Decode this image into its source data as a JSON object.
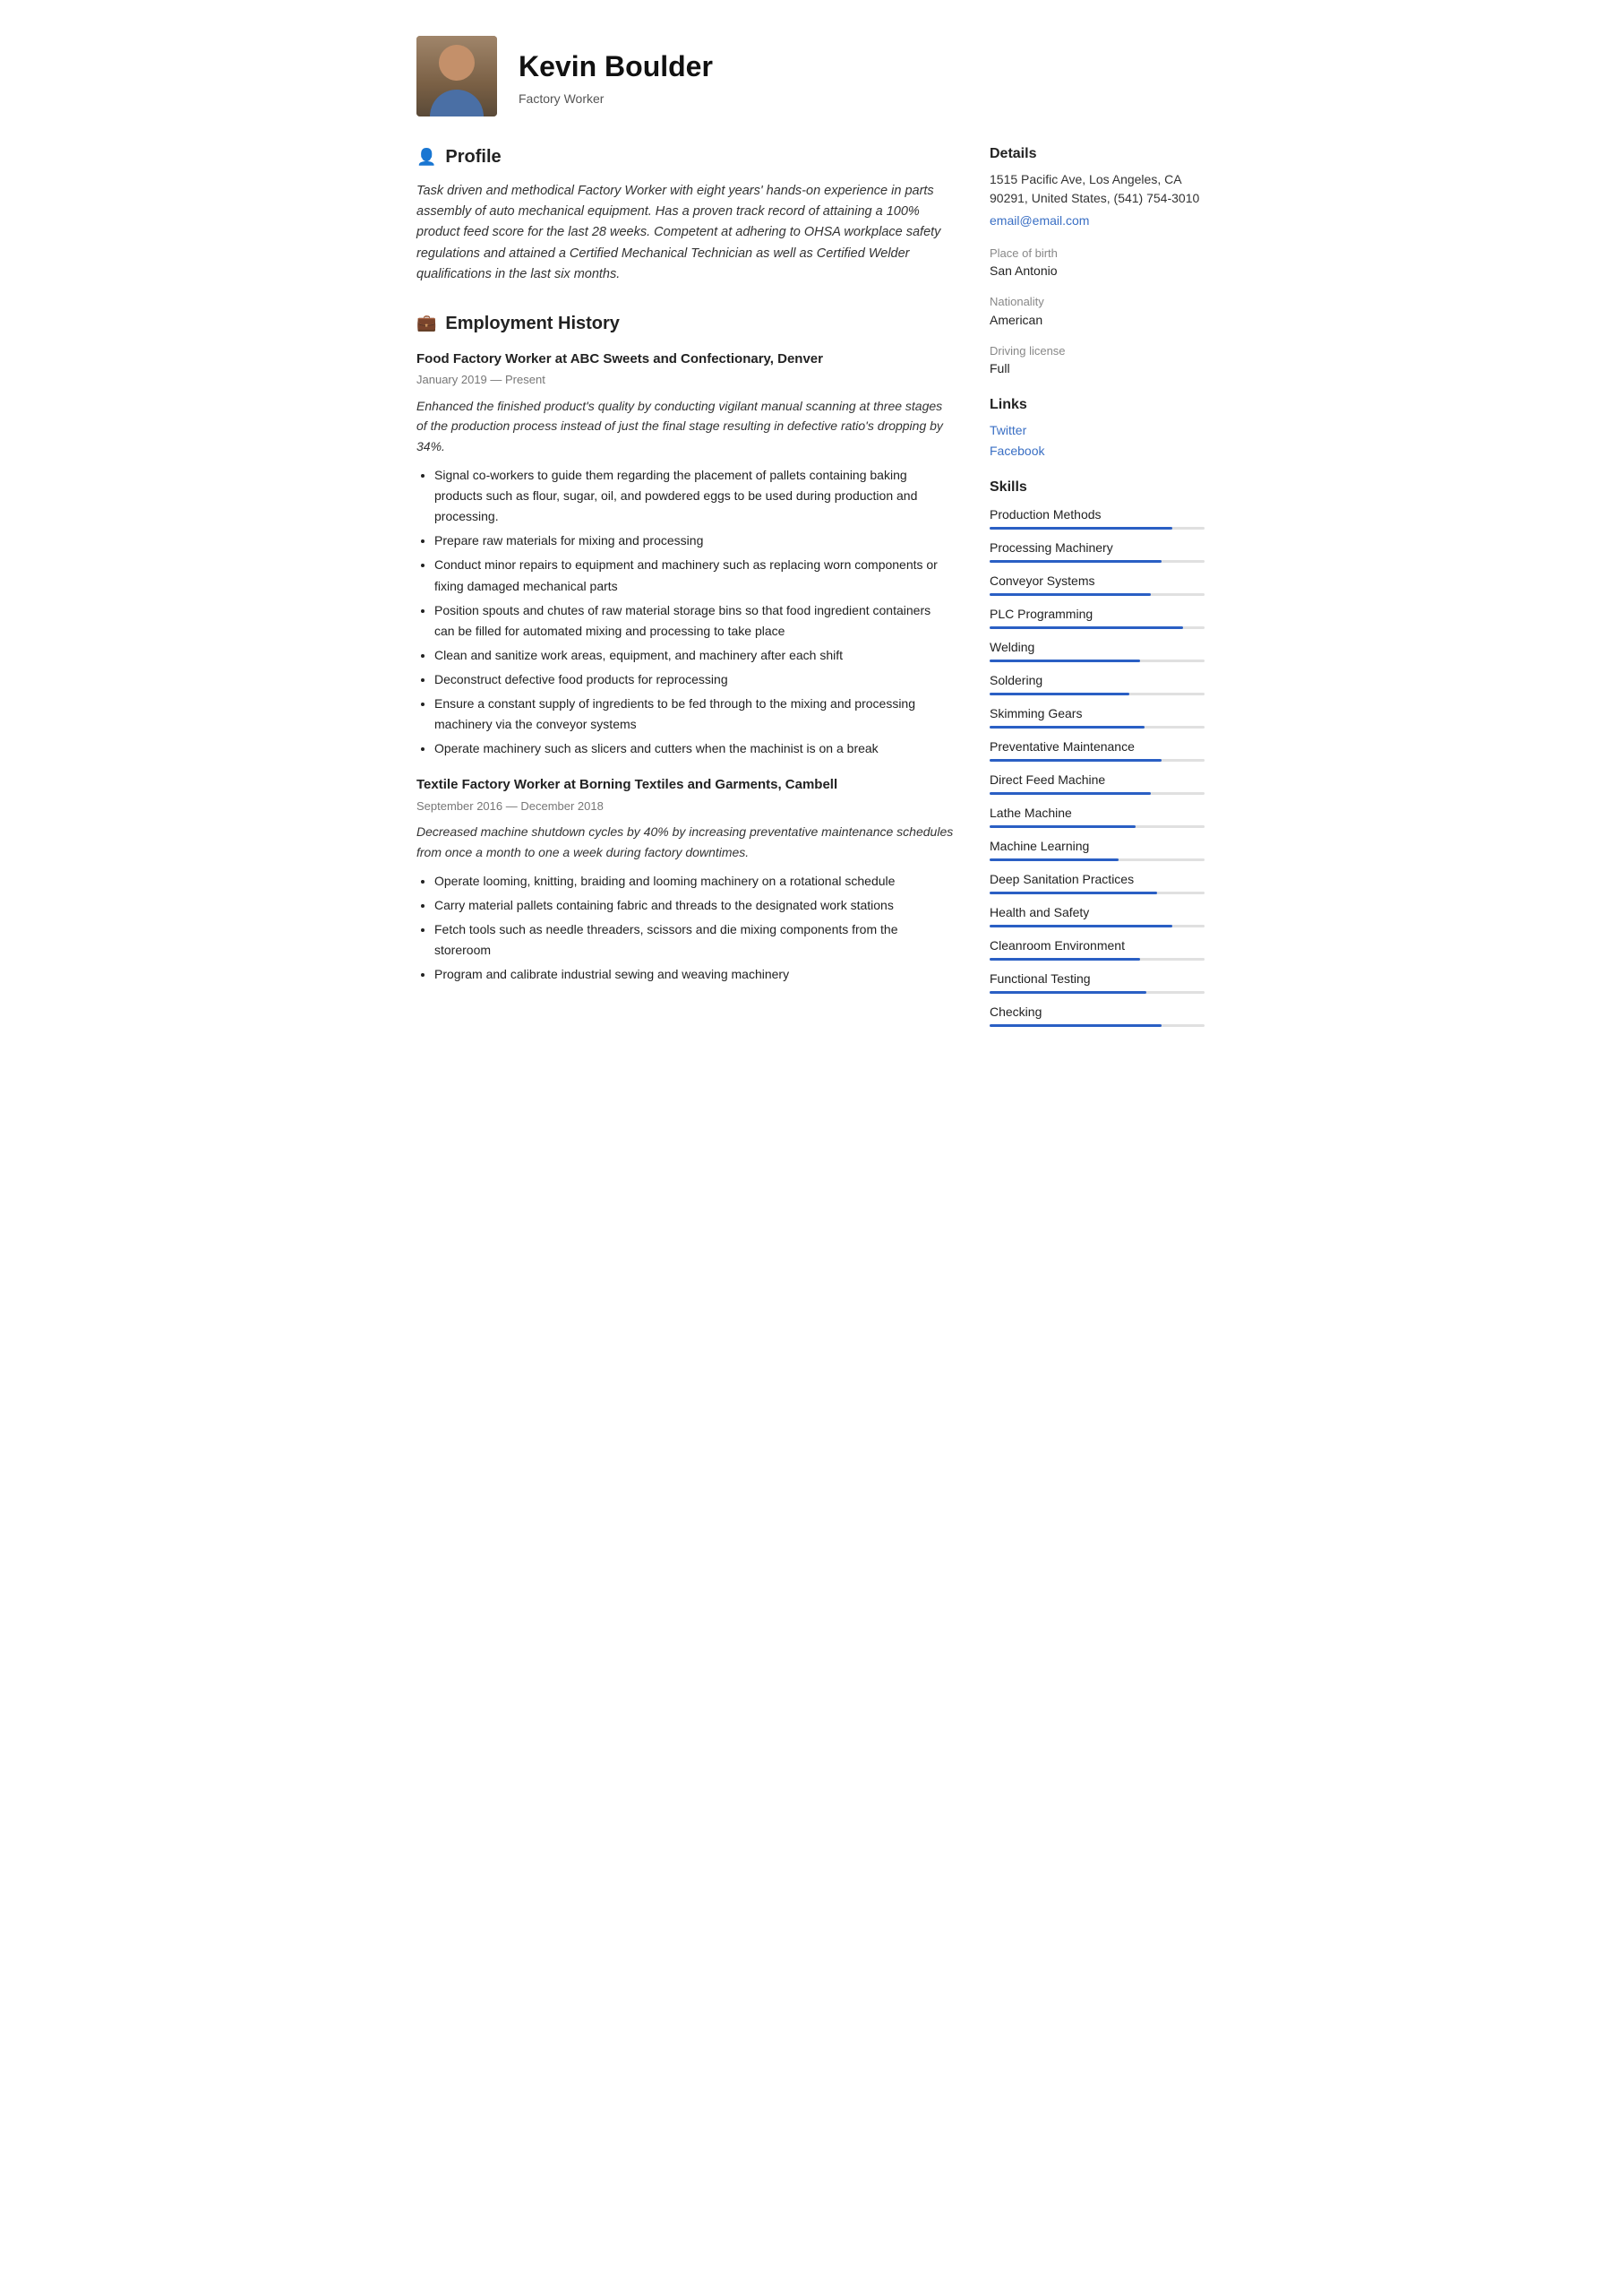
{
  "header": {
    "name": "Kevin Boulder",
    "subtitle": "Factory Worker"
  },
  "profile": {
    "section_title": "Profile",
    "text": "Task driven and methodical Factory Worker with eight years' hands-on experience in parts assembly of auto mechanical equipment. Has a proven track record of attaining a 100% product feed score for the last 28 weeks. Competent at adhering to OHSA workplace safety regulations and attained a Certified Mechanical Technician as well as Certified Welder qualifications in the last six months."
  },
  "employment": {
    "section_title": "Employment History",
    "jobs": [
      {
        "title": "Food Factory Worker at  ABC Sweets and Confectionary, Denver",
        "date": "January 2019 — Present",
        "desc": "Enhanced the finished product's quality by conducting vigilant manual scanning at three stages of the production process instead of just the final stage resulting in defective ratio's dropping by 34%.",
        "bullets": [
          "Signal co-workers to guide them regarding the placement of pallets containing baking products such as flour, sugar, oil, and powdered eggs to be used during production and processing.",
          "Prepare raw materials for mixing and processing",
          "Conduct minor repairs to equipment and machinery such as replacing worn components or fixing damaged mechanical parts",
          "Position spouts and chutes of raw material storage bins so that food ingredient containers can be filled for automated mixing and processing to take place",
          "Clean and sanitize work areas, equipment, and machinery after each shift",
          "Deconstruct defective food products for reprocessing",
          "Ensure a constant supply of ingredients to be fed through to the mixing and processing machinery via the conveyor systems",
          "Operate machinery such as slicers and cutters when the machinist is on a break"
        ]
      },
      {
        "title": "Textile Factory Worker at  Borning Textiles and Garments, Cambell",
        "date": "September 2016 — December 2018",
        "desc": "Decreased machine shutdown cycles by 40% by increasing preventative maintenance schedules from once a month to one a week during factory downtimes.",
        "bullets": [
          "Operate looming, knitting, braiding and looming machinery on a rotational schedule",
          "Carry material pallets containing fabric and threads to the designated work stations",
          "Fetch tools such as needle threaders, scissors and die mixing components from the storeroom",
          "Program and calibrate industrial sewing and weaving machinery"
        ]
      }
    ]
  },
  "details": {
    "title": "Details",
    "address": "1515 Pacific Ave, Los Angeles, CA 90291, United States, (541) 754-3010",
    "email": "email@email.com",
    "place_of_birth_label": "Place of birth",
    "place_of_birth": "San Antonio",
    "nationality_label": "Nationality",
    "nationality": "American",
    "driving_label": "Driving license",
    "driving": "Full"
  },
  "links": {
    "title": "Links",
    "items": [
      {
        "label": "Twitter",
        "url": "#"
      },
      {
        "label": "Facebook",
        "url": "#"
      }
    ]
  },
  "skills": {
    "title": "Skills",
    "items": [
      {
        "name": "Production Methods",
        "fill": 85
      },
      {
        "name": "Processing Machinery",
        "fill": 80
      },
      {
        "name": "Conveyor Systems",
        "fill": 75
      },
      {
        "name": "PLC Programming",
        "fill": 90
      },
      {
        "name": "Welding",
        "fill": 70
      },
      {
        "name": "Soldering",
        "fill": 65
      },
      {
        "name": "Skimming Gears",
        "fill": 72
      },
      {
        "name": "Preventative Maintenance",
        "fill": 80
      },
      {
        "name": "Direct Feed Machine",
        "fill": 75
      },
      {
        "name": "Lathe Machine",
        "fill": 68
      },
      {
        "name": "Machine Learning",
        "fill": 60
      },
      {
        "name": "Deep Sanitation Practices",
        "fill": 78
      },
      {
        "name": "Health and Safety",
        "fill": 85
      },
      {
        "name": "Cleanroom Environment",
        "fill": 70
      },
      {
        "name": "Functional Testing",
        "fill": 73
      },
      {
        "name": "Checking",
        "fill": 80
      }
    ]
  }
}
